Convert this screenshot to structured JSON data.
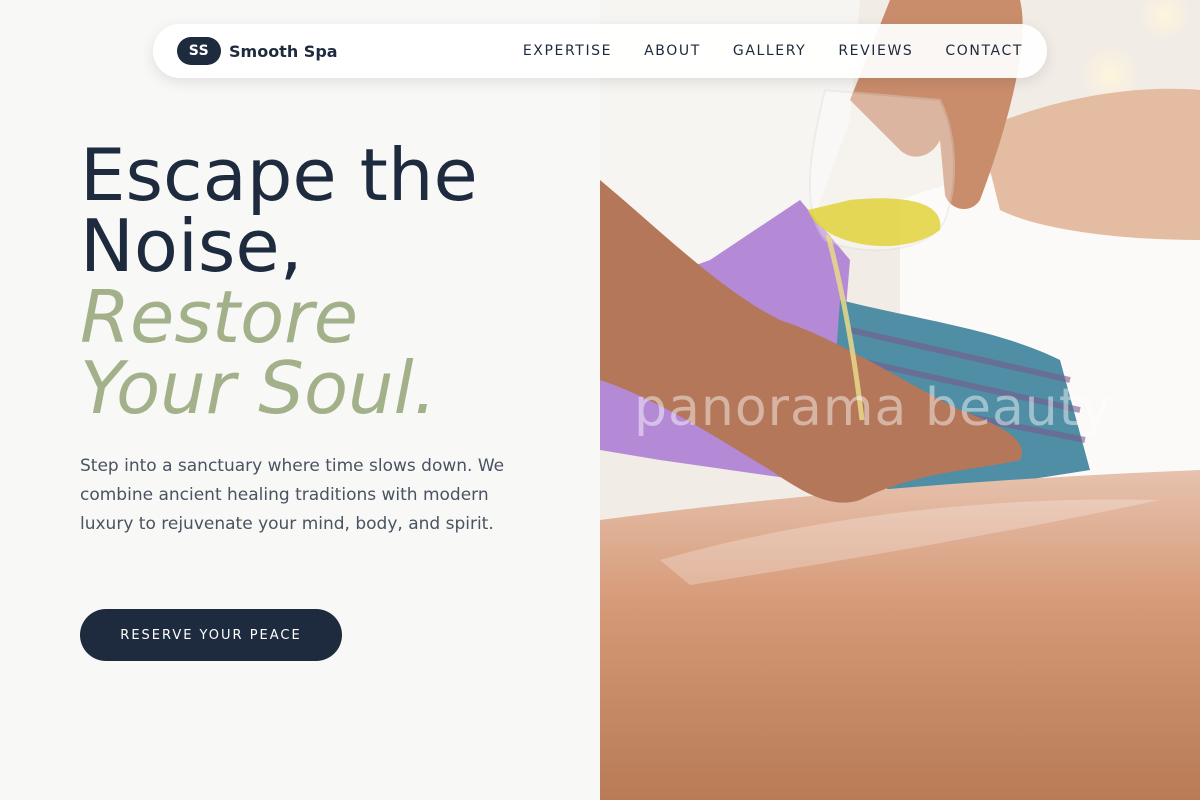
{
  "nav": {
    "logo_initials": "SS",
    "brand_name": "Smooth Spa",
    "items": [
      {
        "label": "EXPERTISE"
      },
      {
        "label": "ABOUT"
      },
      {
        "label": "GALLERY"
      },
      {
        "label": "REVIEWS"
      },
      {
        "label": "CONTACT"
      }
    ]
  },
  "hero": {
    "headline_line1": "Escape the",
    "headline_line2": "Noise,",
    "accent_line1": "Restore",
    "accent_line2": "Your Soul.",
    "description": "Step into a sanctuary where time slows down. We combine ancient healing traditions with modern luxury to rejuvenate your mind, body, and spirit.",
    "cta_label": "RESERVE YOUR PEACE"
  },
  "image": {
    "watermark": "panorama beauty",
    "subject": "massage-oil-pouring"
  },
  "colors": {
    "primary": "#1e2a3d",
    "accent": "#a3b18a",
    "background": "#f8f8f6",
    "body_text": "#4a5361"
  }
}
